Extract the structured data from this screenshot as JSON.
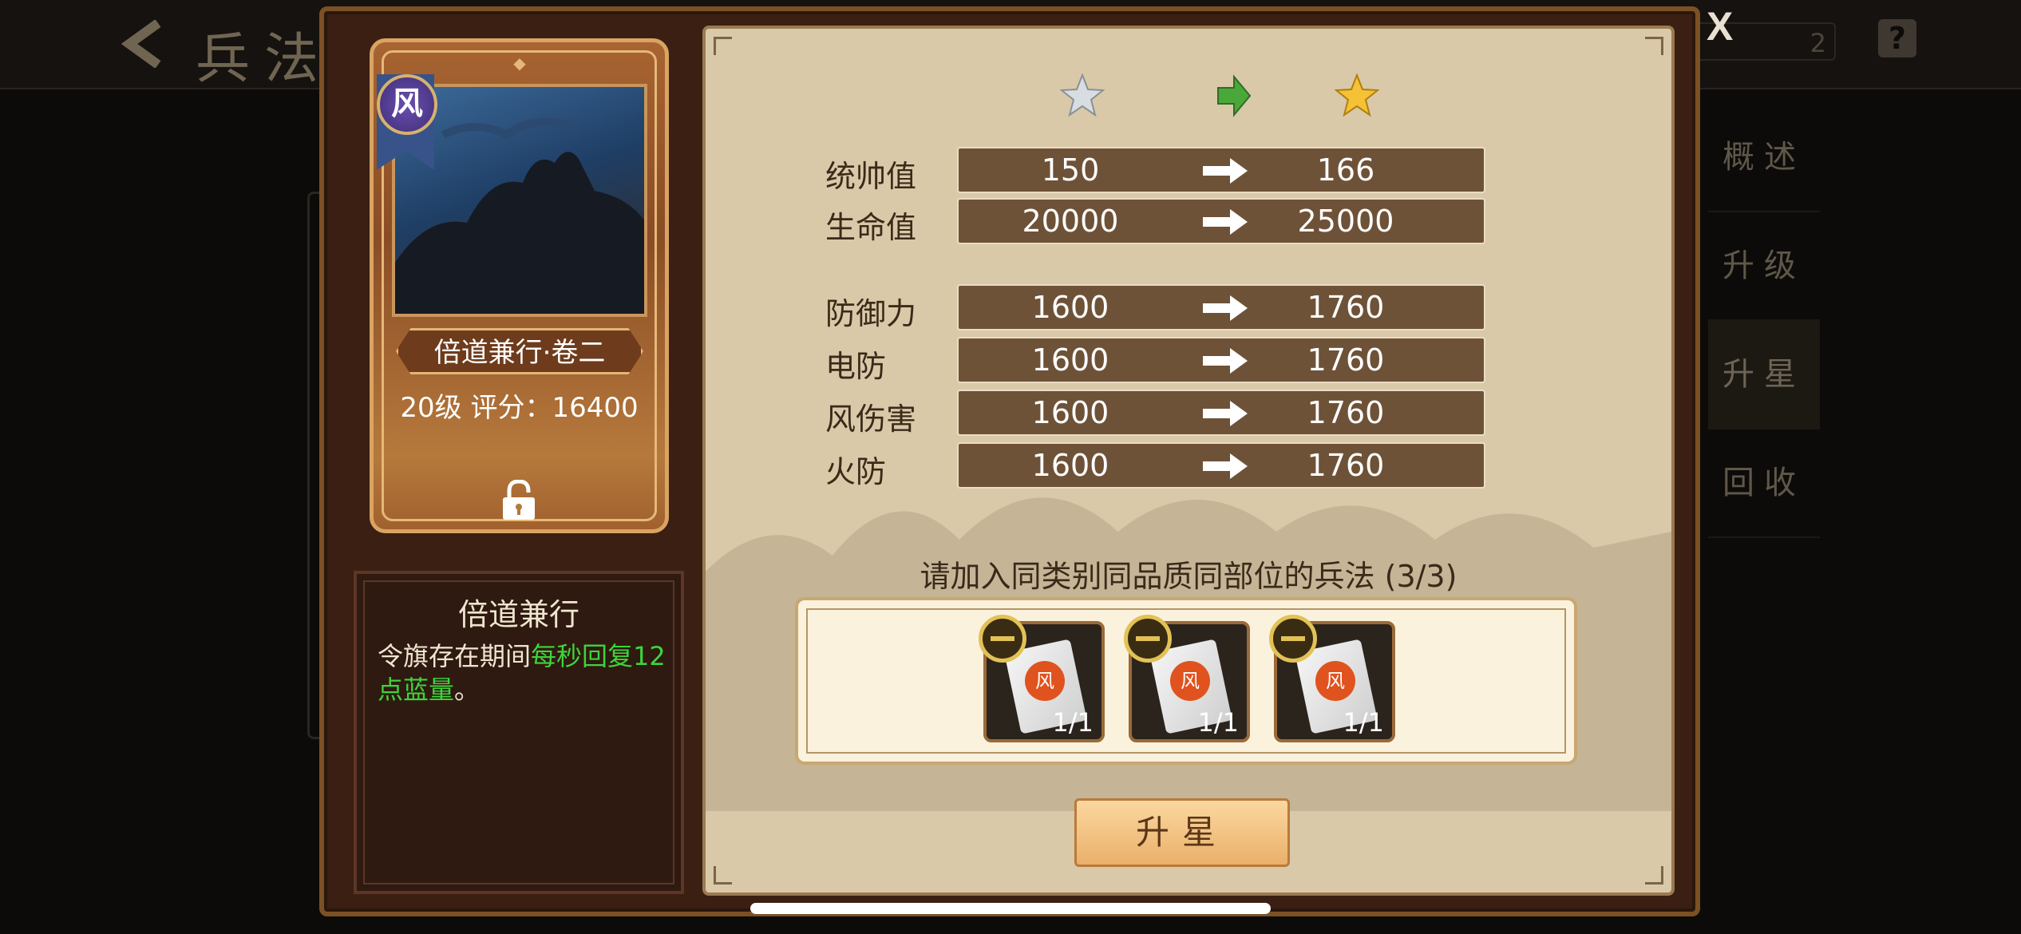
{
  "background": {
    "title": "兵法",
    "search_value": "2",
    "help_label": "?",
    "side_menu": [
      {
        "label": "概述",
        "active": false
      },
      {
        "label": "升级",
        "active": false
      },
      {
        "label": "升星",
        "active": true
      },
      {
        "label": "回收",
        "active": false
      }
    ]
  },
  "dialog": {
    "close_label": "X",
    "card": {
      "element_badge": "风",
      "name": "倍道兼行·卷二",
      "level_score": "20级  评分：16400",
      "locked": true
    },
    "description": {
      "title": "倍道兼行",
      "text_before": "令旗存在期间",
      "text_highlight": "每秒回复12点蓝量",
      "text_after": "。"
    },
    "stars": {
      "from": "silver-star-icon",
      "to": "gold-star-icon"
    },
    "stats_group1": [
      {
        "label": "统帅值",
        "old": "150",
        "new": "166"
      },
      {
        "label": "生命值",
        "old": "20000",
        "new": "25000"
      }
    ],
    "stats_group2": [
      {
        "label": "防御力",
        "old": "1600",
        "new": "1760"
      },
      {
        "label": "电防",
        "old": "1600",
        "new": "1760"
      },
      {
        "label": "风伤害",
        "old": "1600",
        "new": "1760"
      },
      {
        "label": "火防",
        "old": "1600",
        "new": "1760"
      }
    ],
    "prompt": "请加入同类别同品质同部位的兵法 (3/3)",
    "slots": [
      {
        "emblem": "风",
        "count": "1/1"
      },
      {
        "emblem": "风",
        "count": "1/1"
      },
      {
        "emblem": "风",
        "count": "1/1"
      }
    ],
    "upgrade_label": "升星"
  }
}
